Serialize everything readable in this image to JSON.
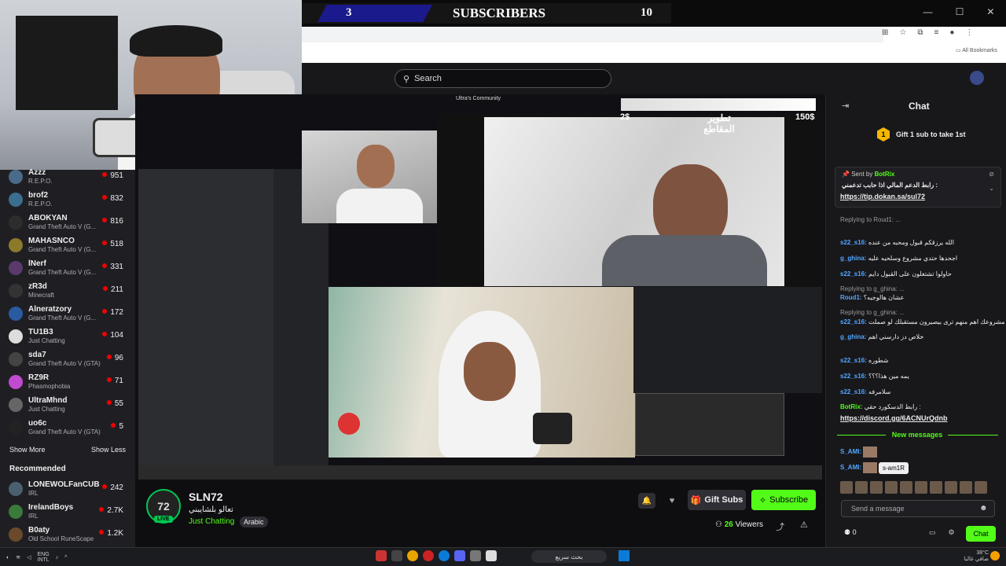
{
  "overlay": {
    "left_count": "3",
    "title": "SUBSCRIBERS",
    "right_count": "10",
    "goal_low": "2$",
    "goal_high": "150$",
    "goal_text": "تطوير المقاطع",
    "community_label": "Ultra's Community"
  },
  "browser": {
    "bookmarks_label": "All Bookmarks"
  },
  "header": {
    "search_placeholder": "Search"
  },
  "sidebar": {
    "channels": [
      {
        "name": "Azzz",
        "category": "R.E.P.O.",
        "viewers": "951",
        "color": "#4a6a8a"
      },
      {
        "name": "brof2",
        "category": "R.E.P.O.",
        "viewers": "832",
        "color": "#3c6e8f"
      },
      {
        "name": "ABOKYAN",
        "category": "Grand Theft Auto V (G...",
        "viewers": "816",
        "color": "#2d2d2d"
      },
      {
        "name": "MAHASNCO",
        "category": "Grand Theft Auto V (G...",
        "viewers": "518",
        "color": "#8a7a2a"
      },
      {
        "name": "lNerf",
        "category": "Grand Theft Auto V (G...",
        "viewers": "331",
        "color": "#5a3a6a"
      },
      {
        "name": "zR3d",
        "category": "Minecraft",
        "viewers": "211",
        "color": "#333"
      },
      {
        "name": "Alneratzory",
        "category": "Grand Theft Auto V (G...",
        "viewers": "172",
        "color": "#2a5aa0"
      },
      {
        "name": "TU1B3",
        "category": "Just Chatting",
        "viewers": "104",
        "color": "#ddd"
      },
      {
        "name": "sda7",
        "category": "Grand Theft Auto V (GTA)",
        "viewers": "96",
        "color": "#444"
      },
      {
        "name": "RZ9R",
        "category": "Phasmophobia",
        "viewers": "71",
        "color": "#c04ad0"
      },
      {
        "name": "UltraMhnd",
        "category": "Just Chatting",
        "viewers": "55",
        "color": "#666"
      },
      {
        "name": "uo6c",
        "category": "Grand Theft Auto V (GTA)",
        "viewers": "5",
        "color": "#222"
      }
    ],
    "show_more": "Show More",
    "show_less": "Show Less",
    "recommended_title": "Recommended",
    "recommended": [
      {
        "name": "LONEWOLFanCUB",
        "category": "IRL",
        "viewers": "242",
        "color": "#4a6070"
      },
      {
        "name": "IrelandBoys",
        "category": "IRL",
        "viewers": "2.7K",
        "color": "#3a7a3a"
      },
      {
        "name": "B0aty",
        "category": "Old School RuneScape",
        "viewers": "1.2K",
        "color": "#6a4a2a"
      }
    ]
  },
  "stream": {
    "channel": "SLN72",
    "avatar_text": "72",
    "live": "LIVE",
    "title": "تعالو بلشايبني",
    "category": "Just Chatting",
    "tag": "Arabic",
    "gift_label": "Gift Subs",
    "subscribe_label": "Subscribe",
    "viewers_count": "26",
    "viewers_label": "Viewers"
  },
  "chat": {
    "title": "Chat",
    "gift_promo_num": "1",
    "gift_promo": "Gift 1 sub to take 1st",
    "pinned_sender_prefix": "Sent by",
    "pinned_sender": "BotRix",
    "pinned_text": "رابط الدعم المالي اذا حابب تدعمني :",
    "pinned_link": "https://tip.dokan.sa/sul72",
    "messages": [
      {
        "reply": "Replying to Roud1: ..."
      },
      {
        "user": "s22_s16:",
        "text": "الله يرزقكم قبول ومحبه من عنده"
      },
      {
        "user": "g_ghina:",
        "text": "اجحدها حتدي مشروع وسلحيه عليه"
      },
      {
        "user": "s22_s16:",
        "text": "حاولوا تشتغلون على القبول دايم"
      },
      {
        "reply": "Replying to g_ghina: ..."
      },
      {
        "user": "Roud1:",
        "text": "عشان هالوجيه؟"
      },
      {
        "reply": "Replying to g_ghina: ..."
      },
      {
        "user": "s22_s16:",
        "text": "مشروعك اهم منهم ترى بيصيرون مستقبلك لو صملت"
      },
      {
        "user": "g_ghina:",
        "text": "خلاص دز دارسني اهم"
      },
      {
        "user": "s22_s16:",
        "text": "شطوره"
      },
      {
        "user": "s22_s16:",
        "text": "يمه مين هذا؟؟؟"
      },
      {
        "user": "s22_s16:",
        "text": "سلامرفه"
      },
      {
        "bot": "BotRix:",
        "text": "رابط الدسكورد حقي :"
      },
      {
        "link": "https://discord.gg/6ACNUrQdnb"
      }
    ],
    "new_messages": "New messages",
    "latest_users": [
      "S_AMI:",
      "S_AMI:"
    ],
    "tooltip": "s-am1R",
    "send_placeholder": "Send a message",
    "points": "0",
    "chat_button": "Chat"
  },
  "taskbar": {
    "lang": "ENG",
    "lang2": "INTL",
    "search_text": "بحث سريع",
    "weather": "38°C",
    "weather_text": "صافي غالبا"
  }
}
